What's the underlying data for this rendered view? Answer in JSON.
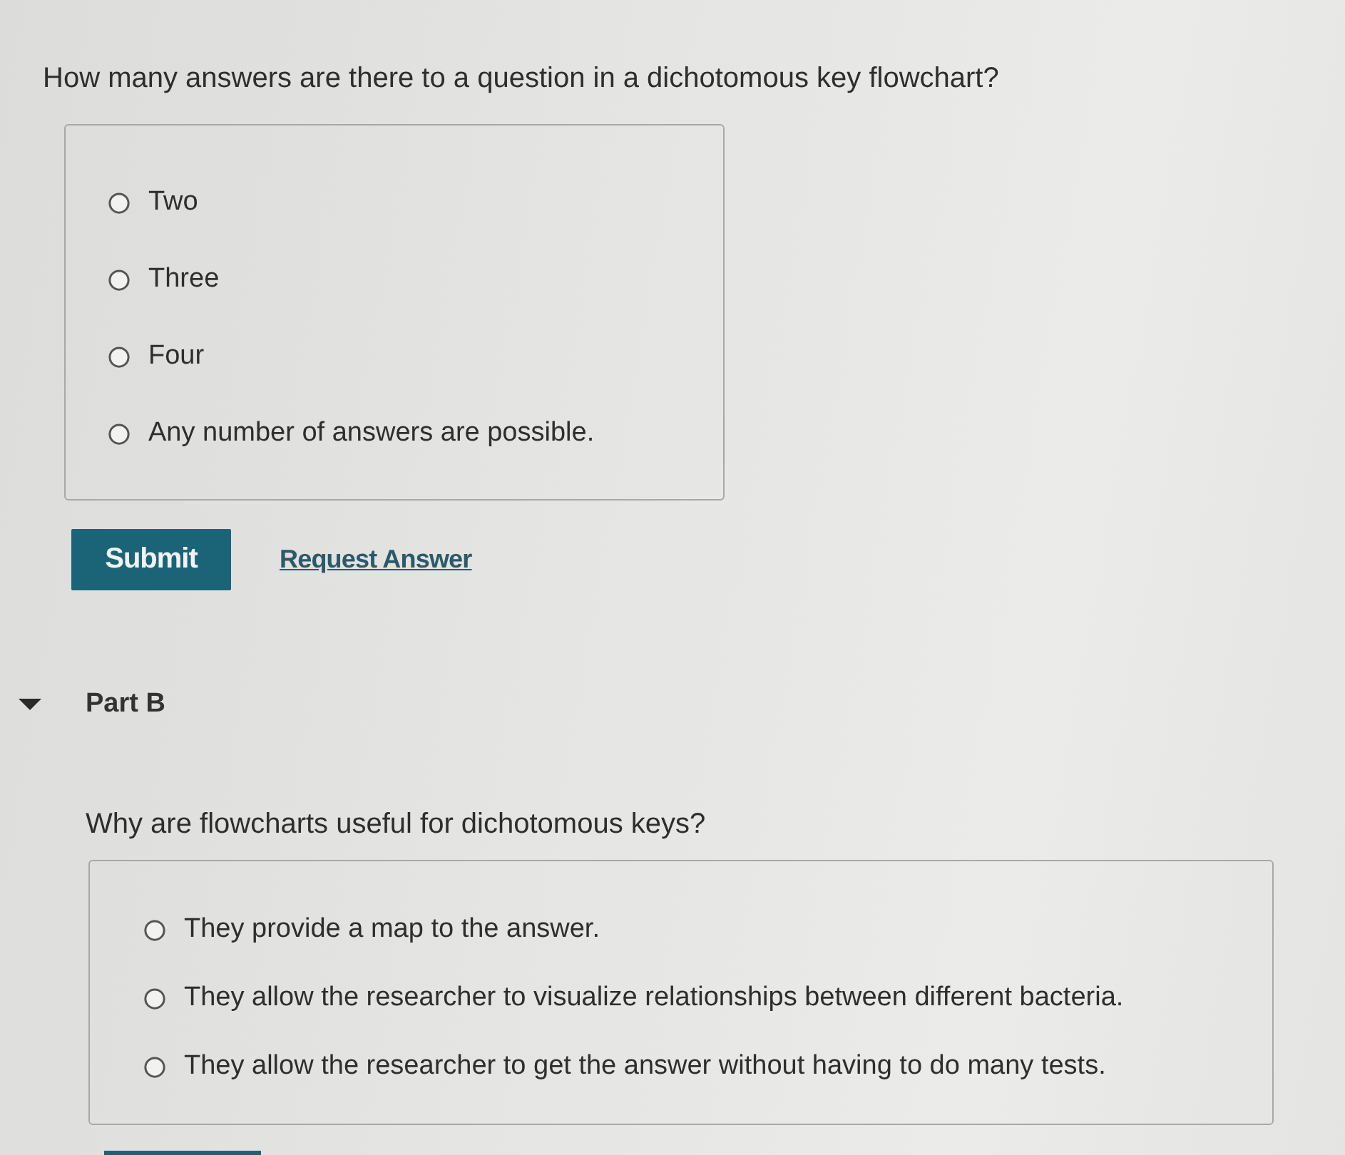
{
  "part_a": {
    "question": "How many answers are there to a question in a dichotomous key flowchart?",
    "options": [
      {
        "label": "Two",
        "selected": false
      },
      {
        "label": "Three",
        "selected": false
      },
      {
        "label": "Four",
        "selected": false
      },
      {
        "label": "Any number of answers are possible.",
        "selected": false
      }
    ],
    "submit_button": "Submit",
    "request_answer_link": "Request Answer"
  },
  "part_b": {
    "title": "Part B",
    "expanded": true,
    "question": "Why are flowcharts useful for dichotomous keys?",
    "options": [
      {
        "label": "They provide a map to the answer.",
        "selected": false
      },
      {
        "label": "They allow the researcher to visualize relationships between different bacteria.",
        "selected": false
      },
      {
        "label": "They allow the researcher to get the answer without having to do many tests.",
        "selected": false
      }
    ]
  }
}
